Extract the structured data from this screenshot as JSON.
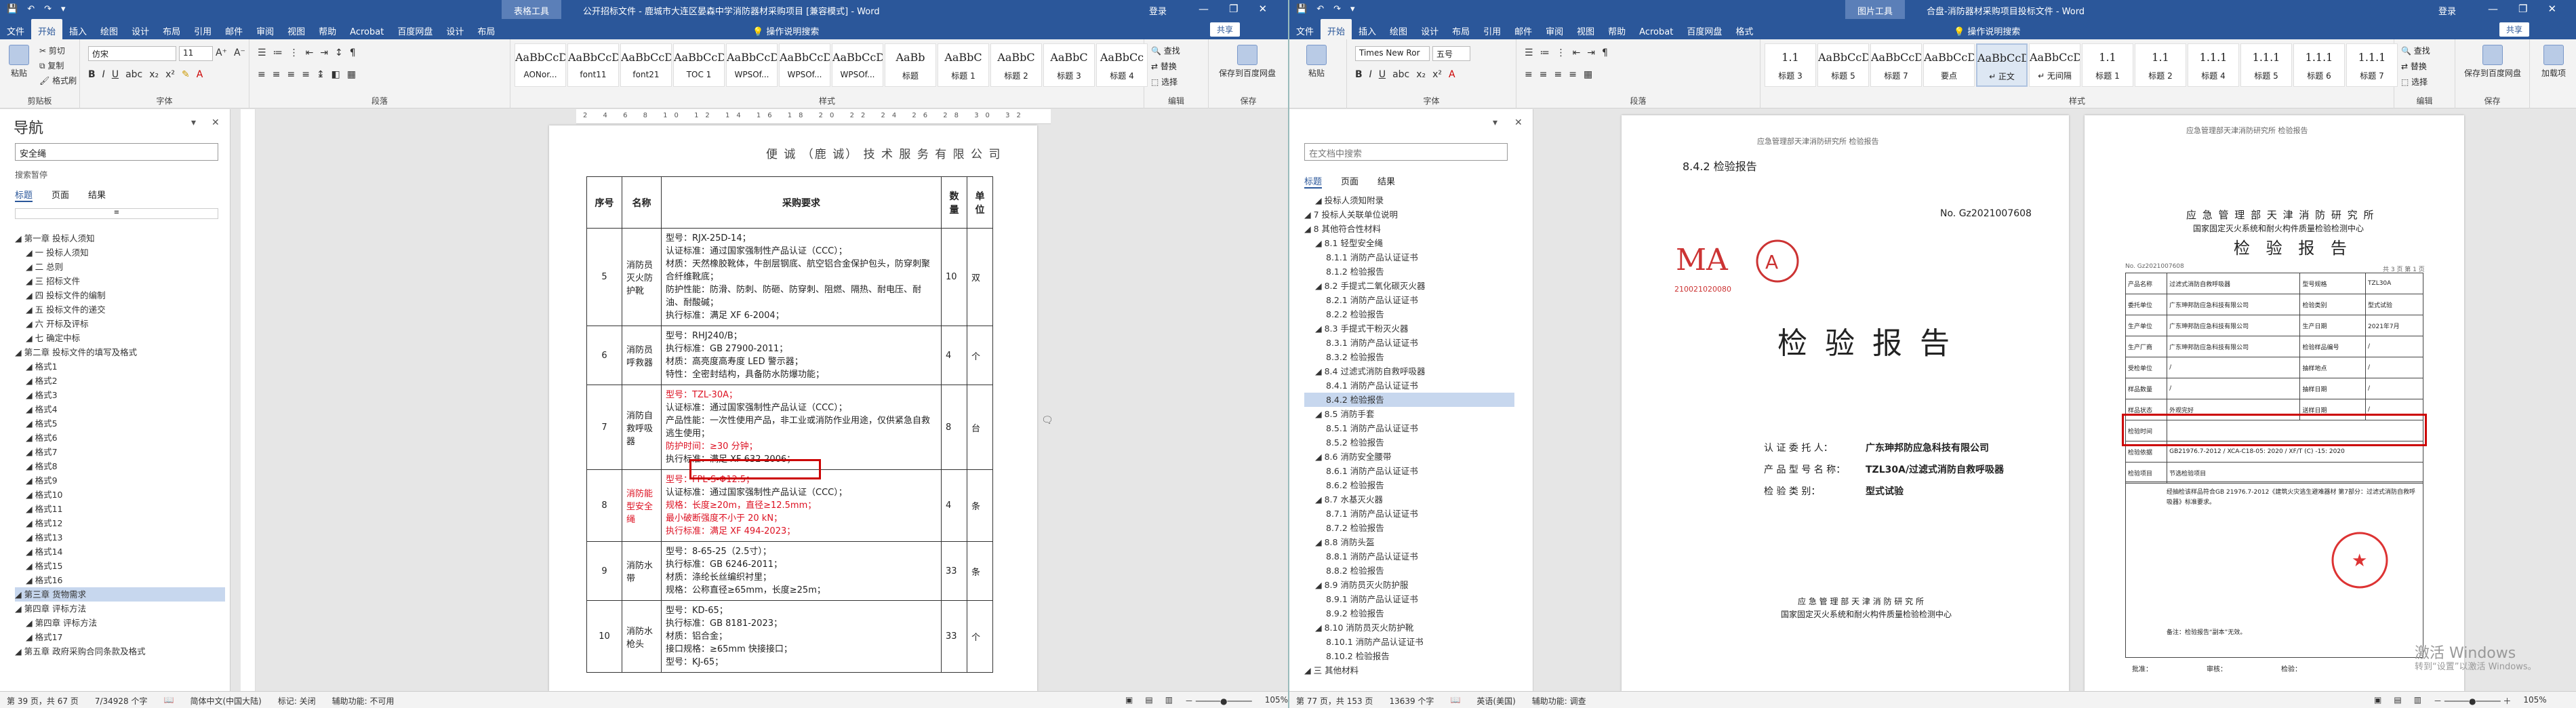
{
  "winA": {
    "title": "公开招标文件 - 鹿城市大连区晏森中学消防器材采购项目 [兼容模式] - Word",
    "context_tab": "表格工具",
    "user": "登录",
    "controls": [
      "—",
      "❐",
      "✕"
    ],
    "tabs": [
      "文件",
      "开始",
      "插入",
      "绘图",
      "设计",
      "布局",
      "引用",
      "邮件",
      "审阅",
      "视图",
      "帮助",
      "Acrobat",
      "百度网盘",
      "设计",
      "布局"
    ],
    "tell_me": "操作说明搜索",
    "share": "共享",
    "clipboard": {
      "paste": "粘贴",
      "cut": "剪切",
      "copy": "复制",
      "painter": "格式刷",
      "label": "剪贴板"
    },
    "font": {
      "name": "仿宋",
      "size": "11",
      "label": "字体"
    },
    "paragraph_label": "段落",
    "styles": [
      {
        "preview": "AaBbCcDc",
        "name": "AONor..."
      },
      {
        "preview": "AaBbCcDc",
        "name": "font11"
      },
      {
        "preview": "AaBbCcDc",
        "name": "font21"
      },
      {
        "preview": "AaBbCcDc",
        "name": "TOC 1"
      },
      {
        "preview": "AaBbCcDc",
        "name": "WPSOf..."
      },
      {
        "preview": "AaBbCcDc",
        "name": "WPSOf..."
      },
      {
        "preview": "AaBbCcDc",
        "name": "WPSOf..."
      },
      {
        "preview": "AaBb",
        "name": "标题"
      },
      {
        "preview": "AaBbC",
        "name": "标题 1"
      },
      {
        "preview": "AaBbC",
        "name": "标题 2"
      },
      {
        "preview": "AaBbC",
        "name": "标题 3"
      },
      {
        "preview": "AaBbCc",
        "name": "标题 4"
      }
    ],
    "styles_label": "样式",
    "editing": {
      "find": "查找",
      "replace": "替换",
      "select": "选择",
      "label": "编辑"
    },
    "acrobat": {
      "save": "保存到百度网盘",
      "label": "保存"
    }
  },
  "nav": {
    "title": "导航",
    "search": "安全绳",
    "sub": "搜索暂停",
    "tabs": [
      "标题",
      "页面",
      "结果"
    ],
    "items": [
      {
        "t": "第一章 投标人须知",
        "lvl": 0
      },
      {
        "t": "一 投标人须知",
        "lvl": 1
      },
      {
        "t": "二 总则",
        "lvl": 1
      },
      {
        "t": "三 招标文件",
        "lvl": 1
      },
      {
        "t": "四 投标文件的编制",
        "lvl": 1
      },
      {
        "t": "五 投标文件的递交",
        "lvl": 1
      },
      {
        "t": "六 开标及评标",
        "lvl": 1
      },
      {
        "t": "七 确定中标",
        "lvl": 1
      },
      {
        "t": "第二章 投标文件的填写及格式",
        "lvl": 0
      },
      {
        "t": "格式1",
        "lvl": 1
      },
      {
        "t": "格式2",
        "lvl": 1
      },
      {
        "t": "格式3",
        "lvl": 1
      },
      {
        "t": "格式4",
        "lvl": 1
      },
      {
        "t": "格式5",
        "lvl": 1
      },
      {
        "t": "格式6",
        "lvl": 1
      },
      {
        "t": "格式7",
        "lvl": 1
      },
      {
        "t": "格式8",
        "lvl": 1
      },
      {
        "t": "格式9",
        "lvl": 1
      },
      {
        "t": "格式10",
        "lvl": 1
      },
      {
        "t": "格式11",
        "lvl": 1
      },
      {
        "t": "格式12",
        "lvl": 1
      },
      {
        "t": "格式13",
        "lvl": 1
      },
      {
        "t": "格式14",
        "lvl": 1
      },
      {
        "t": "格式15",
        "lvl": 1
      },
      {
        "t": "格式16",
        "lvl": 1
      },
      {
        "t": "第三章 货物需求",
        "lvl": 0,
        "sel": true
      },
      {
        "t": "第四章 评标方法",
        "lvl": 0
      },
      {
        "t": "第四章 评标方法",
        "lvl": 1
      },
      {
        "t": "格式17",
        "lvl": 1
      },
      {
        "t": "第五章 政府采购合同条款及格式",
        "lvl": 0
      }
    ]
  },
  "docA": {
    "header": "便 诚 （鹿 诚） 技 术 服 务 有 限 公 司",
    "cols": [
      "序号",
      "名称",
      "采购要求",
      "数量",
      "单位"
    ],
    "rows": [
      {
        "no": "5",
        "name": "消防员灭火防护靴",
        "qty": "10",
        "unit": "双",
        "lines": [
          {
            "t": "型号：RJX-25D-14；"
          },
          {
            "t": "认证标准：通过国家强制性产品认证（CCC）；"
          },
          {
            "t": "材质：天然橡胶靴体，牛剖层钢底、航空铝合金保护包头，防穿刺聚合纤维靴底；"
          },
          {
            "t": "防护性能：防滑、防刺、防砸、防穿刺、阻燃、隔热、耐电压、耐油、耐酸碱；"
          },
          {
            "t": "执行标准：满足 XF 6-2004；"
          }
        ]
      },
      {
        "no": "6",
        "name": "消防员呼救器",
        "qty": "4",
        "unit": "个",
        "lines": [
          {
            "t": "型号：RHJ240/B；"
          },
          {
            "t": "执行标准：GB 27900-2011；"
          },
          {
            "t": "材质：高亮度高寿度 LED 警示器；"
          },
          {
            "t": "特性：全密封结构，具备防水防爆功能；"
          }
        ]
      },
      {
        "no": "7",
        "name": "消防自救呼吸器",
        "qty": "8",
        "unit": "台",
        "lines": [
          {
            "t": "型号：TZL-30A；",
            "red": true
          },
          {
            "t": "认证标准：通过国家强制性产品认证（CCC）；"
          },
          {
            "t": "产品性能：一次性使用产品，非工业或消防作业用途，仅供紧急自救逃生使用；"
          },
          {
            "t": "防护时间：≥30 分钟；",
            "red": true
          },
          {
            "t": "执行标准：满足 XF 632-2006；"
          }
        ]
      },
      {
        "no": "8",
        "name": "消防能型安全绳",
        "qty": "4",
        "unit": "条",
        "red": true,
        "lines": [
          {
            "t": "型号：FPL-S-Φ12.5；",
            "red": true
          },
          {
            "t": "认证标准：通过国家强制性产品认证（CCC）；"
          },
          {
            "t": "规格：长度≥20m，直径≥12.5mm；",
            "red": true
          },
          {
            "t": "最小破断强度不小于 20 kN；",
            "red": true
          },
          {
            "t": "执行标准：满足 XF 494-2023；",
            "red": true
          }
        ]
      },
      {
        "no": "9",
        "name": "消防水带",
        "qty": "33",
        "unit": "条",
        "lines": [
          {
            "t": "型号：8-65-25（2.5寸）；"
          },
          {
            "t": "执行标准：GB 6246-2011；"
          },
          {
            "t": "材质：涤纶长丝编织衬里；"
          },
          {
            "t": "规格：公称直径≥65mm，长度≥25m；"
          }
        ]
      },
      {
        "no": "10",
        "name": "消防水枪头",
        "qty": "33",
        "unit": "个",
        "lines": [
          {
            "t": "型号：KD-65；"
          },
          {
            "t": "执行标准：GB 8181-2023；"
          },
          {
            "t": "材质：铝合金；"
          },
          {
            "t": "接口规格：≥65mm 快接接口；"
          },
          {
            "t": "型号：KJ-65；"
          }
        ]
      }
    ]
  },
  "statusA": {
    "page": "第 39 页，共 67 页",
    "words": "7/34928 个字",
    "lang": "简体中文(中国大陆)",
    "mark": "标记: 关闭",
    "access": "辅助功能: 不可用",
    "zoom": "105%"
  },
  "winB": {
    "title": "合盘-消防器材采购项目投标文件 - Word",
    "context_tab": "图片工具",
    "user": "登录",
    "controls": [
      "—",
      "❐",
      "✕"
    ],
    "tabs": [
      "文件",
      "开始",
      "插入",
      "绘图",
      "设计",
      "布局",
      "引用",
      "邮件",
      "审阅",
      "视图",
      "帮助",
      "Acrobat",
      "百度网盘",
      "格式"
    ],
    "tell_me": "操作说明搜索",
    "share": "共享",
    "font": {
      "name": "Times New Ror",
      "size": "五号",
      "label": "字体"
    },
    "paragraph_label": "段落",
    "styles": [
      {
        "preview": "1.1",
        "name": "标题 3"
      },
      {
        "preview": "AaBbCcDc",
        "name": "标题 5"
      },
      {
        "preview": "AaBbCcDc",
        "name": "标题 7"
      },
      {
        "preview": "AaBbCcDc",
        "name": "要点"
      },
      {
        "preview": "AaBbCcDc",
        "name": "↵ 正文",
        "sel": true
      },
      {
        "preview": "AaBbCcDc",
        "name": "↵ 无间隔"
      },
      {
        "preview": "1.1",
        "name": "标题 1"
      },
      {
        "preview": "1.1",
        "name": "标题 2"
      },
      {
        "preview": "1.1.1",
        "name": "标题 4"
      },
      {
        "preview": "1.1.1",
        "name": "标题 5"
      },
      {
        "preview": "1.1.1",
        "name": "标题 6"
      },
      {
        "preview": "1.1.1",
        "name": "标题 7"
      }
    ],
    "styles_label": "样式",
    "editing": {
      "find": "查找",
      "replace": "替换",
      "select": "选择",
      "label": "编辑"
    },
    "acrobat": {
      "save": "保存到百度网盘",
      "label": "保存"
    },
    "add": "加载项"
  },
  "navB": {
    "search_placeholder": "在文档中搜索",
    "tabs": [
      "标题",
      "页面",
      "结果"
    ],
    "items": [
      {
        "t": "投标人须知附录",
        "lvl": 1
      },
      {
        "t": "7 投标人关联单位说明",
        "lvl": 0
      },
      {
        "t": "8 其他符合性材料",
        "lvl": 0
      },
      {
        "t": "8.1 轻型安全绳",
        "lvl": 1
      },
      {
        "t": "8.1.1 消防产品认证证书",
        "lvl": 2
      },
      {
        "t": "8.1.2 检验报告",
        "lvl": 2
      },
      {
        "t": "8.2 手提式二氧化碳灭火器",
        "lvl": 1
      },
      {
        "t": "8.2.1 消防产品认证证书",
        "lvl": 2
      },
      {
        "t": "8.2.2 检验报告",
        "lvl": 2
      },
      {
        "t": "8.3 手提式干粉灭火器",
        "lvl": 1
      },
      {
        "t": "8.3.1 消防产品认证证书",
        "lvl": 2
      },
      {
        "t": "8.3.2 检验报告",
        "lvl": 2
      },
      {
        "t": "8.4 过滤式消防自救呼吸器",
        "lvl": 1
      },
      {
        "t": "8.4.1 消防产品认证证书",
        "lvl": 2
      },
      {
        "t": "8.4.2 检验报告",
        "lvl": 2,
        "sel": true
      },
      {
        "t": "8.5 消防手套",
        "lvl": 1
      },
      {
        "t": "8.5.1 消防产品认证证书",
        "lvl": 2
      },
      {
        "t": "8.5.2 检验报告",
        "lvl": 2
      },
      {
        "t": "8.6 消防安全腰带",
        "lvl": 1
      },
      {
        "t": "8.6.1 消防产品认证证书",
        "lvl": 2
      },
      {
        "t": "8.6.2 检验报告",
        "lvl": 2
      },
      {
        "t": "8.7 水基灭火器",
        "lvl": 1
      },
      {
        "t": "8.7.1 消防产品认证证书",
        "lvl": 2
      },
      {
        "t": "8.7.2 检验报告",
        "lvl": 2
      },
      {
        "t": "8.8 消防头盔",
        "lvl": 1
      },
      {
        "t": "8.8.1 消防产品认证证书",
        "lvl": 2
      },
      {
        "t": "8.8.2 检验报告",
        "lvl": 2
      },
      {
        "t": "8.9 消防员灭火防护服",
        "lvl": 1
      },
      {
        "t": "8.9.1 消防产品认证证书",
        "lvl": 2
      },
      {
        "t": "8.9.2 检验报告",
        "lvl": 2
      },
      {
        "t": "8.10 消防员灭火防护靴",
        "lvl": 1
      },
      {
        "t": "8.10.1 消防产品认证证书",
        "lvl": 2
      },
      {
        "t": "8.10.2 检验报告",
        "lvl": 2
      },
      {
        "t": "三 其他材料",
        "lvl": 0
      }
    ]
  },
  "docB": {
    "header": "应急管理部天津消防研究所 检验报告",
    "section": "8.4.2 检验报告",
    "report_no": "No. Gz2021007608",
    "cma_no": "210021020080",
    "title": "检 验 报 告",
    "fields": [
      {
        "k": "认 证 委 托 人：",
        "v": "广东珅邦防应急科技有限公司"
      },
      {
        "k": "产 品 型 号 名 称：",
        "v": "TZL30A/过滤式消防自救呼吸器"
      },
      {
        "k": "检 验 类 别：",
        "v": "型式试验"
      }
    ],
    "footer1": "应 急 管 理 部 天 津 消 防 研 究 所",
    "footer2": "国家固定灭火系统和耐火构件质量检验检测中心"
  },
  "docC": {
    "header": "应急管理部天津消防研究所 检验报告",
    "org": "应 急 管 理 部 天 津 消 防 研 究 所",
    "center": "国家固定灭火系统和耐火构件质量检验检测中心",
    "title": "检 验 报 告",
    "page_no": "共 3 页 第 1 页",
    "report_no": "No. Gz2021007608",
    "rows": [
      [
        "产品名称",
        "过滤式消防自救呼吸器",
        "型号规格",
        "TZL30A"
      ],
      [
        "委托单位",
        "广东珅邦防应急科技有限公司",
        "检验类别",
        "型式试验"
      ],
      [
        "生产单位",
        "广东珅邦防应急科技有限公司",
        "生产日期",
        "2021年7月"
      ],
      [
        "生产厂商",
        "广东珅邦防应急科技有限公司",
        "检验样品编号",
        "/"
      ],
      [
        "受检单位",
        "/",
        "抽样地点",
        "/"
      ],
      [
        "样品数量",
        "/",
        "抽样日期",
        "/"
      ],
      [
        "样品状态",
        "外观完好",
        "送样日期",
        "/"
      ],
      [
        "检验时间",
        "",
        "",
        ""
      ],
      [
        "检验依据",
        "GB21976.7-2012 / XCA-C18-05: 2020 / XF/T (C) -15: 2020",
        "",
        ""
      ],
      [
        "检验项目",
        "节选检验项目",
        "",
        ""
      ]
    ],
    "conclusion": "经抽检该样品符合GB 21976.7-2012《建筑火灾逃生避难器材 第7部分：过滤式消防自救呼吸器》标准要求。",
    "sign1": "批准：",
    "sign2": "审核：",
    "sign3": "检验：",
    "note": "备注：检验报告“副本”无效。"
  },
  "statusB": {
    "page": "第 77 页，共 153 页",
    "words": "13639 个字",
    "lang": "英语(美国)",
    "access": "辅助功能: 调查",
    "zoom": "105%"
  },
  "activate": {
    "line1": "激活 Windows",
    "line2": "转到“设置”以激活 Windows。"
  }
}
